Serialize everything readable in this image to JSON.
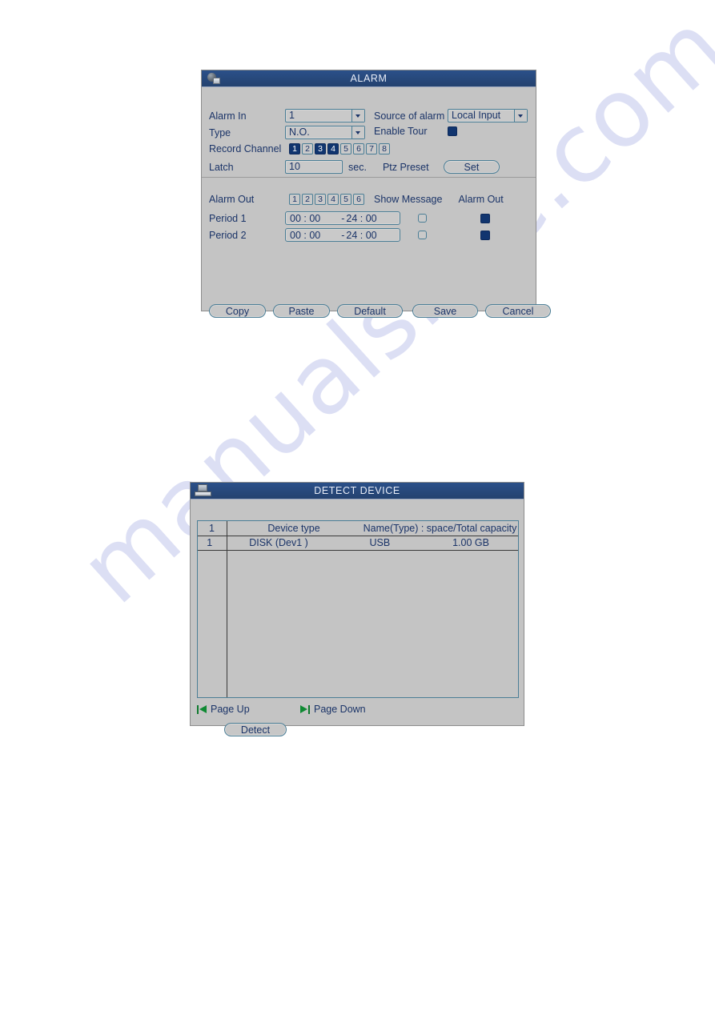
{
  "page": {
    "watermark_text": "manualslive.com",
    "watermark_color": "#dcdff4",
    "background_color": "#ffffff"
  },
  "theme": {
    "titlebar_color": "#24426f",
    "body_color": "#c4c4c4",
    "text_color": "#1b3468",
    "accent_fill": "#11356f",
    "border_color": "#4b7e96",
    "pager_icon_color": "#0f8a33"
  },
  "alarm_dialog": {
    "title": "ALARM",
    "title_icon": "camera-icon",
    "fields": {
      "alarm_in_label": "Alarm In",
      "alarm_in_value": "1",
      "source_of_alarm_label": "Source of alarm",
      "source_of_alarm_value": "Local Input",
      "type_label": "Type",
      "type_value": "N.O.",
      "enable_tour_label": "Enable Tour",
      "enable_tour_checked": true,
      "record_channel_label": "Record Channel",
      "record_channels": [
        {
          "label": "1",
          "on": true
        },
        {
          "label": "2",
          "on": false
        },
        {
          "label": "3",
          "on": true
        },
        {
          "label": "4",
          "on": true
        },
        {
          "label": "5",
          "on": false
        },
        {
          "label": "6",
          "on": false
        },
        {
          "label": "7",
          "on": false
        },
        {
          "label": "8",
          "on": false
        }
      ],
      "latch_label": "Latch",
      "latch_value": "10",
      "latch_unit": "sec.",
      "ptz_preset_label": "Ptz Preset",
      "ptz_preset_button": "Set",
      "alarm_out_label": "Alarm Out",
      "alarm_out_channels": [
        {
          "label": "1",
          "on": false
        },
        {
          "label": "2",
          "on": false
        },
        {
          "label": "3",
          "on": false
        },
        {
          "label": "4",
          "on": false
        },
        {
          "label": "5",
          "on": false
        },
        {
          "label": "6",
          "on": false
        }
      ],
      "show_message_header": "Show Message",
      "alarm_out_header": "Alarm Out",
      "period_1_label": "Period 1",
      "period_1_start": "00 : 00",
      "period_1_dash": "-",
      "period_1_end": "24 : 00",
      "period_1_show_message": false,
      "period_1_alarm_out": true,
      "period_2_label": "Period 2",
      "period_2_start": "00 : 00",
      "period_2_dash": "-",
      "period_2_end": "24 : 00",
      "period_2_show_message": false,
      "period_2_alarm_out": true
    },
    "buttons": {
      "copy": "Copy",
      "paste": "Paste",
      "default": "Default",
      "save": "Save",
      "cancel": "Cancel"
    }
  },
  "detect_device_dialog": {
    "title": "DETECT DEVICE",
    "title_icon": "device-icon",
    "table": {
      "header": {
        "index": "1",
        "device_type": "Device type",
        "capacity": "Name(Type) : space/Total capacity"
      },
      "rows": [
        {
          "index": "1",
          "device_type": "DISK (Dev1 )",
          "name": "USB",
          "size": "1.00 GB"
        }
      ]
    },
    "pager": {
      "page_up": "Page Up",
      "page_up_icon": "page-up-icon",
      "page_down": "Page Down",
      "page_down_icon": "page-down-icon"
    },
    "buttons": {
      "detect": "Detect"
    }
  }
}
